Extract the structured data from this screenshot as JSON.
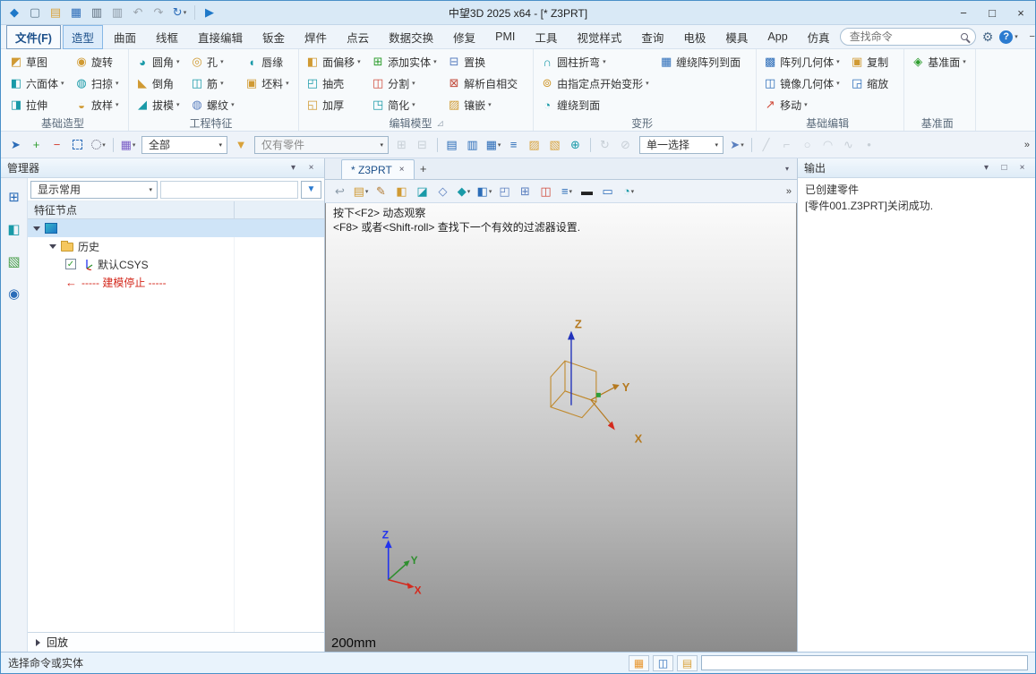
{
  "chrome": {
    "minimize": "−",
    "maximize": "□",
    "close": "×",
    "caret": "▾",
    "pin": "▾",
    "plus": "+",
    "panel_close": "×",
    "panel_max": "□",
    "help": "?",
    "check": "✓",
    "stop_arrow": "←"
  },
  "window": {
    "title": "中望3D 2025 x64 - [*  Z3PRT]",
    "quick_access": [
      {
        "name": "app-logo-icon",
        "glyph": "◆",
        "color": "#1e78c8",
        "arrow": ""
      },
      {
        "name": "new-file-icon",
        "glyph": "▢",
        "color": "#5f7a8d",
        "arrow": ""
      },
      {
        "name": "open-template-icon",
        "glyph": "▤",
        "color": "#d9a23a",
        "arrow": ""
      },
      {
        "name": "save-icon",
        "glyph": "▦",
        "color": "#2b6cb8",
        "arrow": ""
      },
      {
        "name": "print-icon",
        "glyph": "▥",
        "color": "#5a6a7a",
        "arrow": ""
      },
      {
        "name": "batch-print-icon",
        "glyph": "▥",
        "color": "#8a97a3",
        "arrow": ""
      },
      {
        "name": "undo-icon",
        "glyph": "↶",
        "color": "#9aa4ad",
        "arrow": ""
      },
      {
        "name": "redo-icon",
        "glyph": "↷",
        "color": "#9aa4ad",
        "arrow": ""
      },
      {
        "name": "regen-icon",
        "glyph": "↻",
        "color": "#2b6cb8",
        "arrow": "▾"
      },
      {
        "name": "separator",
        "glyph": "",
        "color": "",
        "arrow": ""
      },
      {
        "name": "play-icon",
        "glyph": "▶",
        "color": "#1e78c8",
        "arrow": ""
      }
    ]
  },
  "menu": {
    "tabs": [
      {
        "name": "tab-file",
        "label": "文件(F)",
        "state": "file"
      },
      {
        "name": "tab-shape",
        "label": "造型",
        "state": "active"
      },
      {
        "name": "tab-surface",
        "label": "曲面",
        "state": ""
      },
      {
        "name": "tab-wireframe",
        "label": "线框",
        "state": ""
      },
      {
        "name": "tab-direct-edit",
        "label": "直接编辑",
        "state": ""
      },
      {
        "name": "tab-sheet-metal",
        "label": "钣金",
        "state": ""
      },
      {
        "name": "tab-weldment",
        "label": "焊件",
        "state": ""
      },
      {
        "name": "tab-point-cloud",
        "label": "点云",
        "state": ""
      },
      {
        "name": "tab-data-exchange",
        "label": "数据交换",
        "state": ""
      },
      {
        "name": "tab-repair",
        "label": "修复",
        "state": ""
      },
      {
        "name": "tab-pmi",
        "label": "PMI",
        "state": ""
      },
      {
        "name": "tab-tools",
        "label": "工具",
        "state": ""
      },
      {
        "name": "tab-visual-style",
        "label": "视觉样式",
        "state": ""
      },
      {
        "name": "tab-inquire",
        "label": "查询",
        "state": ""
      },
      {
        "name": "tab-electrode",
        "label": "电极",
        "state": ""
      },
      {
        "name": "tab-mold",
        "label": "模具",
        "state": ""
      },
      {
        "name": "tab-app",
        "label": "App",
        "state": ""
      },
      {
        "name": "tab-simulation",
        "label": "仿真",
        "state": ""
      }
    ],
    "search_placeholder": "查找命令"
  },
  "ribbon": {
    "groups": [
      {
        "name": "group-basic-shape",
        "label": "基础造型",
        "launcher": "",
        "buttons": [
          {
            "name": "sketch-button",
            "label": "草图",
            "glyph": "◩",
            "color": "#d09a33",
            "arrow": ""
          },
          {
            "name": "box-button",
            "label": "六面体",
            "glyph": "◧",
            "color": "#1a9aa8",
            "arrow": "▾"
          },
          {
            "name": "extrude-button",
            "label": "拉伸",
            "glyph": "◨",
            "color": "#1a9aa8",
            "arrow": ""
          },
          {
            "name": "revolve-button",
            "label": "旋转",
            "glyph": "◉",
            "color": "#d09a33",
            "arrow": ""
          },
          {
            "name": "sweep-button",
            "label": "扫掠",
            "glyph": "◍",
            "color": "#1a9aa8",
            "arrow": "▾"
          },
          {
            "name": "loft-button",
            "label": "放样",
            "glyph": "◒",
            "color": "#d09a33",
            "arrow": "▾"
          }
        ]
      },
      {
        "name": "group-engineering-feature",
        "label": "工程特征",
        "launcher": "",
        "buttons": [
          {
            "name": "fillet-button",
            "label": "圆角",
            "glyph": "◕",
            "color": "#1a9aa8",
            "arrow": "▾"
          },
          {
            "name": "chamfer-button",
            "label": "倒角",
            "glyph": "◣",
            "color": "#d09a33",
            "arrow": ""
          },
          {
            "name": "draft-button",
            "label": "拔模",
            "glyph": "◢",
            "color": "#1a9aa8",
            "arrow": "▾"
          },
          {
            "name": "hole-button",
            "label": "孔",
            "glyph": "◎",
            "color": "#d09a33",
            "arrow": "▾"
          },
          {
            "name": "rib-button",
            "label": "筋",
            "glyph": "◫",
            "color": "#1a9aa8",
            "arrow": "▾"
          },
          {
            "name": "thread-button",
            "label": "螺纹",
            "glyph": "◍",
            "color": "#5a7fbf",
            "arrow": "▾"
          },
          {
            "name": "lip-button",
            "label": "唇缘",
            "glyph": "◖",
            "color": "#1a9aa8",
            "arrow": ""
          },
          {
            "name": "stock-button",
            "label": "坯料",
            "glyph": "▣",
            "color": "#d09a33",
            "arrow": "▾"
          }
        ]
      },
      {
        "name": "group-edit-model",
        "label": "编辑模型",
        "launcher": "◿",
        "buttons": [
          {
            "name": "offset-face-button",
            "label": "面偏移",
            "glyph": "◧",
            "color": "#d09a33",
            "arrow": "▾"
          },
          {
            "name": "shell-button",
            "label": "抽壳",
            "glyph": "◰",
            "color": "#1a9aa8",
            "arrow": ""
          },
          {
            "name": "thicken-button",
            "label": "加厚",
            "glyph": "◱",
            "color": "#d09a33",
            "arrow": ""
          },
          {
            "name": "add-shape-button",
            "label": "添加实体",
            "glyph": "⊞",
            "color": "#2f9e2f",
            "arrow": "▾"
          },
          {
            "name": "divide-button",
            "label": "分割",
            "glyph": "◫",
            "color": "#d04a3a",
            "arrow": "▾"
          },
          {
            "name": "simplify-button",
            "label": "简化",
            "glyph": "◳",
            "color": "#1a9aa8",
            "arrow": "▾"
          },
          {
            "name": "replace-button",
            "label": "置换",
            "glyph": "⊟",
            "color": "#5a7fbf",
            "arrow": ""
          },
          {
            "name": "heal-self-intersection-button",
            "label": "解析自相交",
            "glyph": "⊠",
            "color": "#c24a3a",
            "arrow": ""
          },
          {
            "name": "inlay-button",
            "label": "镶嵌",
            "glyph": "▨",
            "color": "#d09a33",
            "arrow": "▾"
          }
        ]
      },
      {
        "name": "group-morph",
        "label": "变形",
        "launcher": "",
        "buttons": [
          {
            "name": "cylindrical-bend-button",
            "label": "圆柱折弯",
            "glyph": "∩",
            "color": "#1a9aa8",
            "arrow": "▾"
          },
          {
            "name": "deform-from-point-button",
            "label": "由指定点开始变形",
            "glyph": "⊚",
            "color": "#d09a33",
            "arrow": "▾"
          },
          {
            "name": "wrap-to-face-button",
            "label": "缠绕到面",
            "glyph": "◔",
            "color": "#1a9aa8",
            "arrow": ""
          },
          {
            "name": "wrap-pattern-to-face-button",
            "label": "缠绕阵列到面",
            "glyph": "▦",
            "color": "#2b6cb8",
            "arrow": ""
          }
        ]
      },
      {
        "name": "group-basic-edit",
        "label": "基础编辑",
        "launcher": "",
        "buttons": [
          {
            "name": "pattern-geometry-button",
            "label": "阵列几何体",
            "glyph": "▩",
            "color": "#2b6cb8",
            "arrow": "▾"
          },
          {
            "name": "mirror-geometry-button",
            "label": "镜像几何体",
            "glyph": "◫",
            "color": "#2b6cb8",
            "arrow": "▾"
          },
          {
            "name": "move-button",
            "label": "移动",
            "glyph": "↗",
            "color": "#d04a3a",
            "arrow": "▾"
          },
          {
            "name": "copy-button",
            "label": "复制",
            "glyph": "▣",
            "color": "#d09a33",
            "arrow": ""
          },
          {
            "name": "scale-button",
            "label": "缩放",
            "glyph": "◲",
            "color": "#2b6cb8",
            "arrow": ""
          }
        ]
      },
      {
        "name": "group-datum",
        "label": "基准面",
        "launcher": "",
        "buttons": [
          {
            "name": "datum-plane-button",
            "label": "基准面",
            "glyph": "◈",
            "color": "#2f9e2f",
            "arrow": "▾"
          }
        ]
      }
    ]
  },
  "toolbar": {
    "icons_a": [
      {
        "name": "pick-arrow-icon",
        "glyph": "➤",
        "color": "#2b6cb8",
        "arrow": "",
        "state": ""
      },
      {
        "name": "add-pick-icon",
        "glyph": "+",
        "color": "#2f9e2f",
        "arrow": "",
        "state": ""
      },
      {
        "name": "remove-pick-icon",
        "glyph": "−",
        "color": "#d23b2f",
        "arrow": "",
        "state": ""
      },
      {
        "name": "pick-box-icon",
        "glyph": "",
        "color": "",
        "arrow": "",
        "state": ""
      },
      {
        "name": "pick-circle-icon",
        "glyph": "",
        "color": "",
        "arrow": "▾",
        "state": ""
      },
      {
        "name": "separator",
        "glyph": "",
        "color": "",
        "arrow": "",
        "state": ""
      },
      {
        "name": "color-filter-icon",
        "glyph": "▦",
        "color": "#7b5ec7",
        "arrow": "▾",
        "state": ""
      }
    ],
    "display_filter": "全部",
    "funnel": {
      "name": "entity-filter-funnel-icon",
      "glyph": "▼",
      "color": "#d9a23a"
    },
    "entity_filter": "仅有零件",
    "icons_b": [
      {
        "name": "filter-add-icon",
        "glyph": "⊞",
        "color": "#9aa4ad",
        "arrow": "",
        "state": "disabled"
      },
      {
        "name": "filter-clear-icon",
        "glyph": "⊟",
        "color": "#9aa4ad",
        "arrow": "",
        "state": "disabled"
      },
      {
        "name": "separator",
        "glyph": "",
        "color": "",
        "arrow": "",
        "state": ""
      },
      {
        "name": "align-list-icon",
        "glyph": "▤",
        "color": "#2b6cb8",
        "arrow": "",
        "state": ""
      },
      {
        "name": "align-columns-icon",
        "glyph": "▥",
        "color": "#2b6cb8",
        "arrow": "",
        "state": ""
      },
      {
        "name": "view-list-icon",
        "glyph": "▦",
        "color": "#2b6cb8",
        "arrow": "▾",
        "state": ""
      },
      {
        "name": "sort-list-icon",
        "glyph": "≡",
        "color": "#2b6cb8",
        "arrow": "",
        "state": ""
      },
      {
        "name": "folder-view-icon",
        "glyph": "▨",
        "color": "#d9a23a",
        "arrow": "",
        "state": ""
      },
      {
        "name": "bom-table-icon",
        "glyph": "▧",
        "color": "#d9a23a",
        "arrow": "",
        "state": ""
      },
      {
        "name": "link-manager-icon",
        "glyph": "⊕",
        "color": "#1a9aa8",
        "arrow": "",
        "state": ""
      },
      {
        "name": "separator",
        "glyph": "",
        "color": "",
        "arrow": "",
        "state": ""
      },
      {
        "name": "refresh-display-icon",
        "glyph": "↻",
        "color": "#9aa4ad",
        "arrow": "",
        "state": "disabled"
      },
      {
        "name": "section-off-icon",
        "glyph": "⊘",
        "color": "#9aa4ad",
        "arrow": "",
        "state": "disabled"
      }
    ],
    "pick_mode": "单一选择",
    "icons_c": [
      {
        "name": "pick-filter-icon",
        "glyph": "➤",
        "color": "#5a7fbf",
        "arrow": "▾",
        "state": ""
      },
      {
        "name": "separator",
        "glyph": "",
        "color": "",
        "arrow": "",
        "state": ""
      },
      {
        "name": "line-tool-icon",
        "glyph": "╱",
        "color": "#9aa4ad",
        "arrow": "",
        "state": "disabled"
      },
      {
        "name": "polyline-tool-icon",
        "glyph": "⌐",
        "color": "#9aa4ad",
        "arrow": "",
        "state": "disabled"
      },
      {
        "name": "circle-tool-icon",
        "glyph": "○",
        "color": "#9aa4ad",
        "arrow": "",
        "state": "disabled"
      },
      {
        "name": "arc-tool-icon",
        "glyph": "◠",
        "color": "#9aa4ad",
        "arrow": "",
        "state": "disabled"
      },
      {
        "name": "spline-tool-icon",
        "glyph": "∿",
        "color": "#9aa4ad",
        "arrow": "",
        "state": "disabled"
      },
      {
        "name": "point-tool-icon",
        "glyph": "•",
        "color": "#9aa4ad",
        "arrow": "",
        "state": "disabled"
      }
    ],
    "overflow": "»"
  },
  "manager": {
    "title": "管理器",
    "filter_select": "显示常用",
    "column_header": "特征节点",
    "side_icons": [
      {
        "name": "manager-icon",
        "glyph": "⊞",
        "color": "#2b6cb8"
      },
      {
        "name": "visual-manager-icon",
        "glyph": "◧",
        "color": "#1a9aa8"
      },
      {
        "name": "image-manager-icon",
        "glyph": "▧",
        "color": "#4a9e4a"
      },
      {
        "name": "find-icon",
        "glyph": "◉",
        "color": "#2b6cb8"
      }
    ],
    "tree": {
      "history_label": "历史",
      "csys_label": "默认CSYS",
      "stop_label": "----- 建模停止 -----"
    },
    "replay_label": "回放"
  },
  "canvas": {
    "tab_label": "* Z3PRT",
    "hints": [
      "按下<F2> 动态观察",
      "<F8> 或者<Shift-roll> 查找下一个有效的过滤器设置."
    ],
    "toolbar_icons": [
      {
        "name": "back-icon",
        "glyph": "↩",
        "color": "#8a9aa8",
        "arrow": "",
        "state": ""
      },
      {
        "name": "sheet-new-icon",
        "glyph": "▤",
        "color": "#d09a33",
        "arrow": "▾",
        "state": ""
      },
      {
        "name": "sketch-pen-icon",
        "glyph": "✎",
        "color": "#b0782f",
        "arrow": "",
        "state": ""
      },
      {
        "name": "appearance-icon",
        "glyph": "◧",
        "color": "#d09a33",
        "arrow": "",
        "state": ""
      },
      {
        "name": "shaded-display-icon",
        "glyph": "◪",
        "color": "#1a9aa8",
        "arrow": "",
        "state": ""
      },
      {
        "name": "wireframe-display-icon",
        "glyph": "◇",
        "color": "#5a7fbf",
        "arrow": "",
        "state": ""
      },
      {
        "name": "display-mode-icon",
        "glyph": "◆",
        "color": "#1a9aa8",
        "arrow": "▾",
        "state": ""
      },
      {
        "name": "view-orientation-icon",
        "glyph": "◧",
        "color": "#2b6cb8",
        "arrow": "▾",
        "state": ""
      },
      {
        "name": "perspective-icon",
        "glyph": "◰",
        "color": "#5a7fbf",
        "arrow": "",
        "state": ""
      },
      {
        "name": "zoom-window-icon",
        "glyph": "⊞",
        "color": "#5a7fbf",
        "arrow": "",
        "state": ""
      },
      {
        "name": "section-view-icon",
        "glyph": "◫",
        "color": "#d04a3a",
        "arrow": "",
        "state": ""
      },
      {
        "name": "layer-icon",
        "glyph": "≡",
        "color": "#2b6cb8",
        "arrow": "▾",
        "state": ""
      },
      {
        "name": "background-icon",
        "glyph": "▬",
        "color": "#222222",
        "arrow": "",
        "state": ""
      },
      {
        "name": "viewport-border-icon",
        "glyph": "▭",
        "color": "#2b6cb8",
        "arrow": "",
        "state": ""
      },
      {
        "name": "environment-icon",
        "glyph": "◔",
        "color": "#1a9aa8",
        "arrow": "▾",
        "state": ""
      }
    ],
    "overflow": "»",
    "triad_main": {
      "x": "X",
      "y": "Y",
      "z": "Z"
    },
    "triad_mini": {
      "x": "X",
      "y": "Y",
      "z": "Z"
    },
    "scale_label": "200mm"
  },
  "output": {
    "title": "输出",
    "lines": [
      "已创建零件",
      "[零件001.Z3PRT]关闭成功."
    ]
  },
  "status": {
    "message": "选择命令或实体",
    "icons": [
      {
        "name": "table-toggle-icon",
        "glyph": "▦",
        "color": "#e8962e"
      },
      {
        "name": "display-toggle-icon",
        "glyph": "◫",
        "color": "#2b6cb8"
      },
      {
        "name": "list-toggle-icon",
        "glyph": "▤",
        "color": "#d9a23a"
      }
    ]
  }
}
